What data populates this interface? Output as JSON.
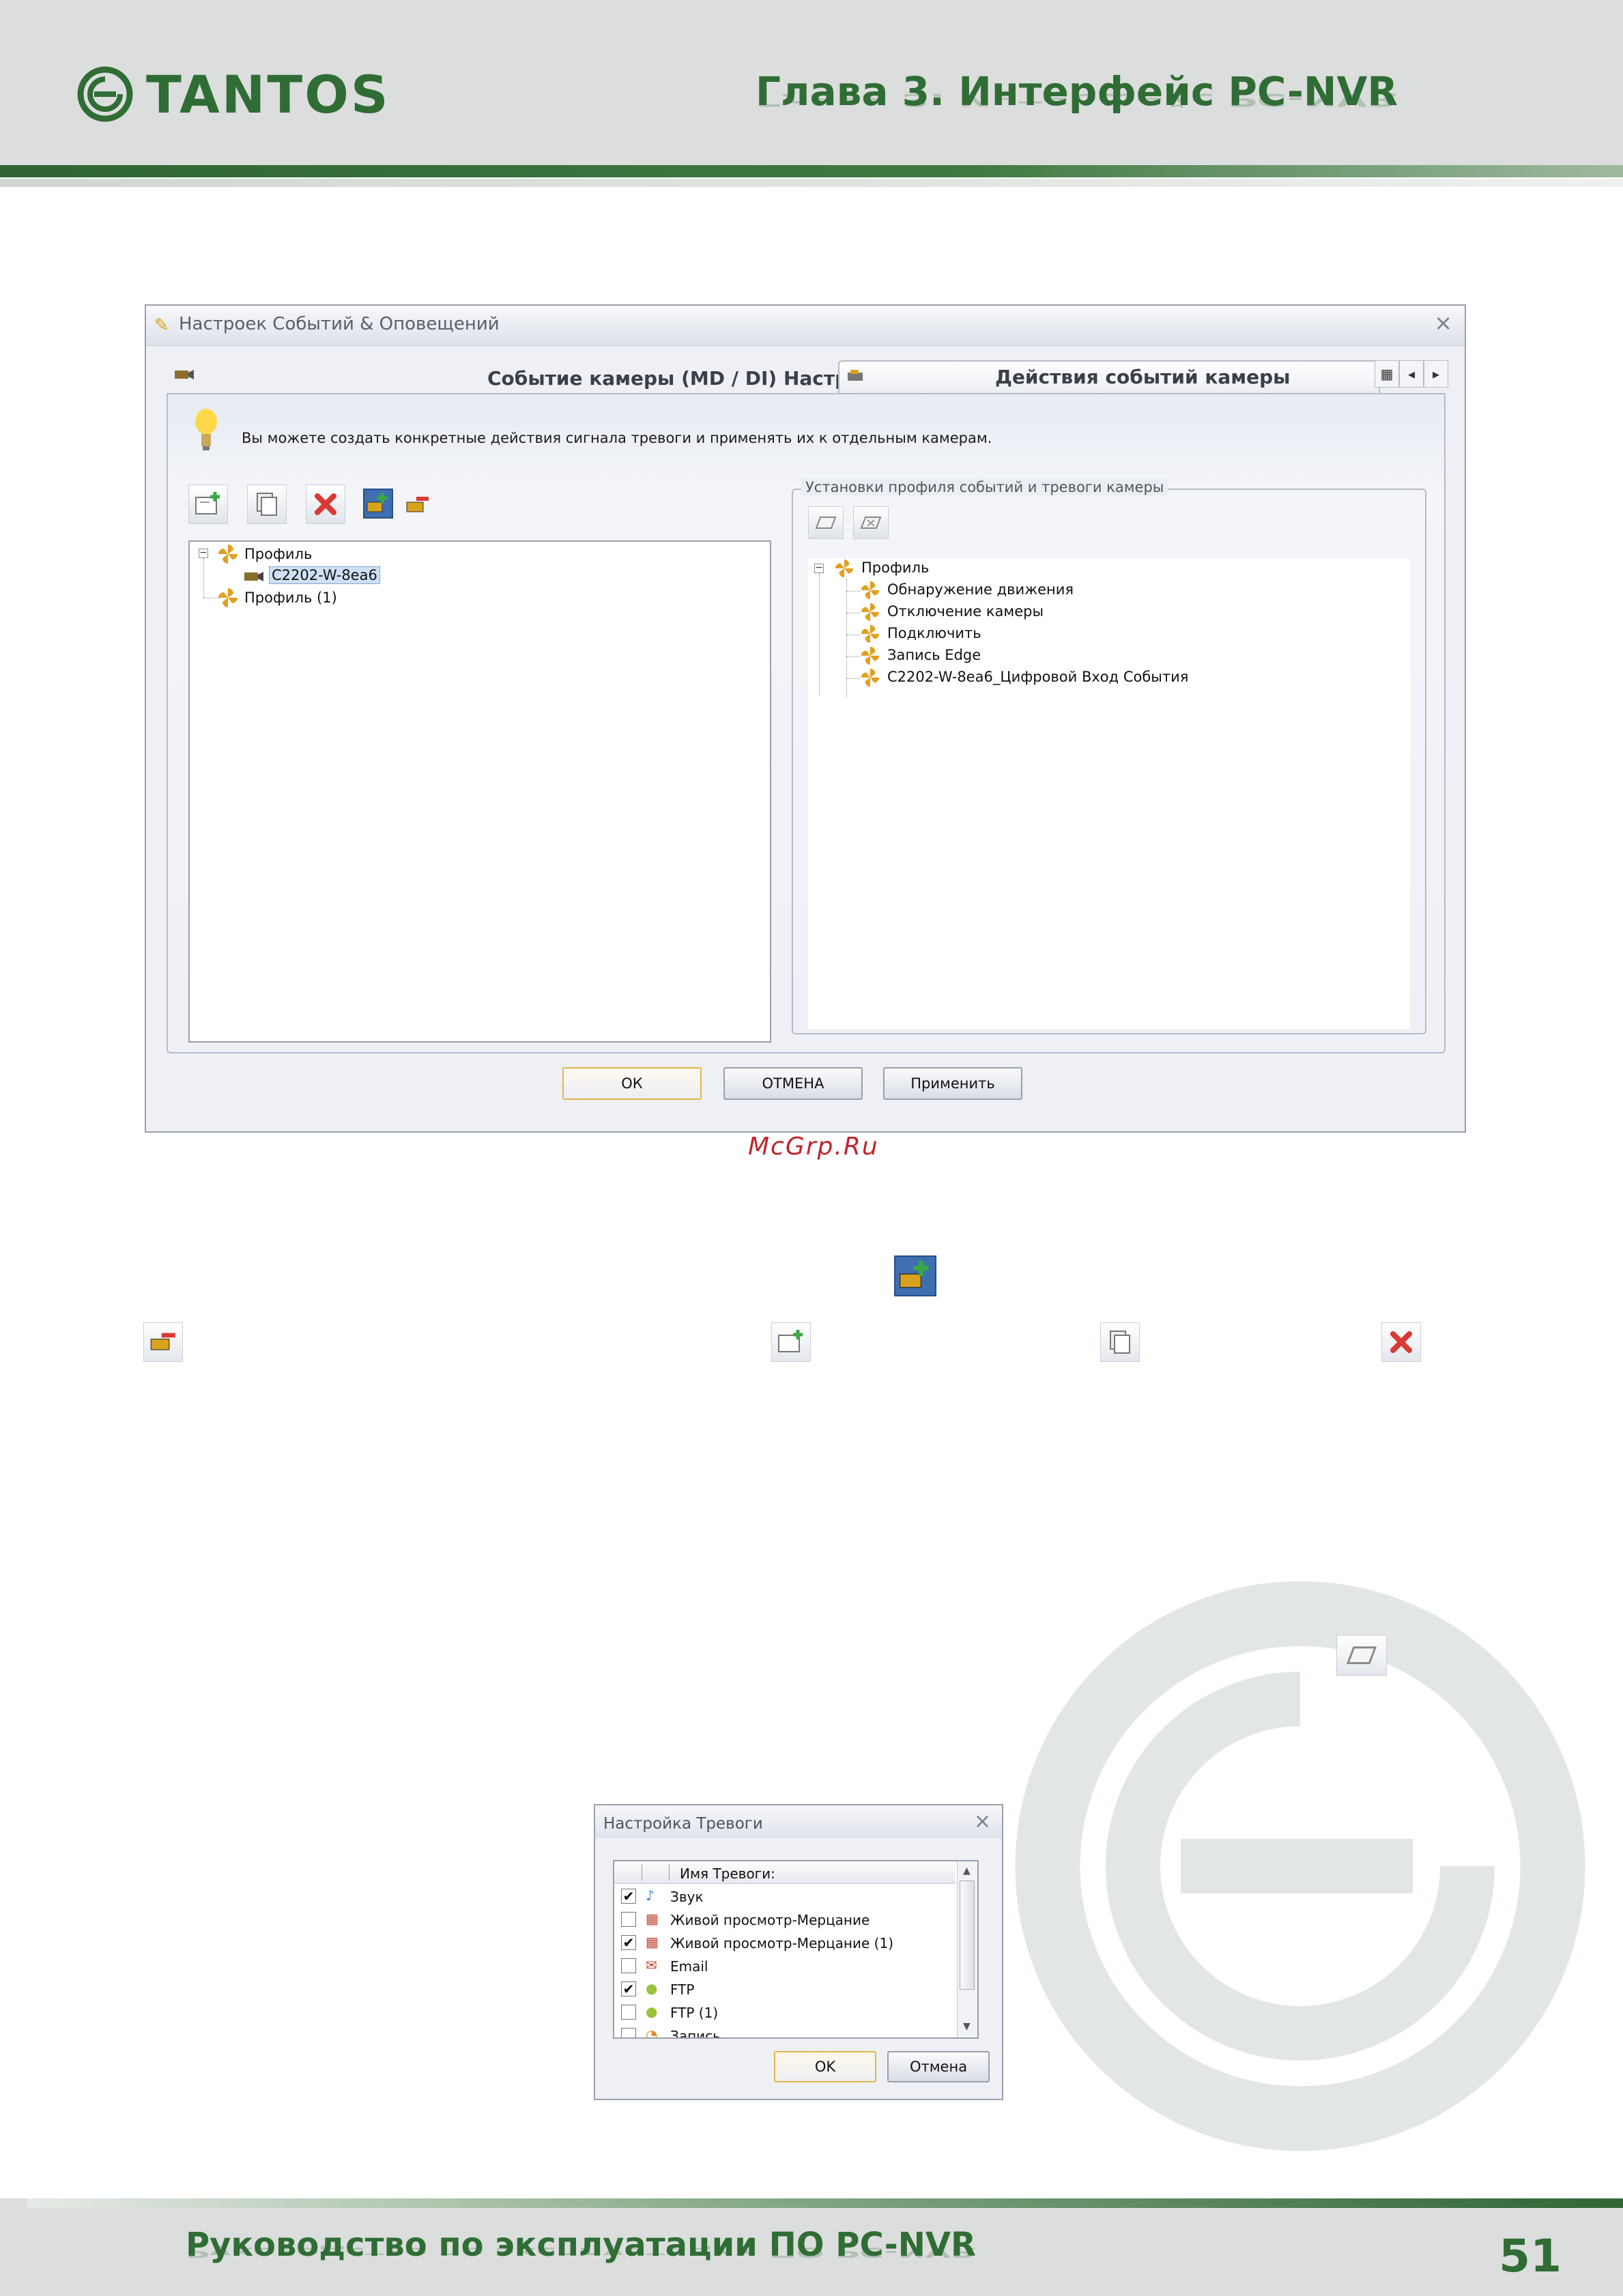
{
  "header": {
    "brand": "TANTOS",
    "chapter": "Глава 3. Интерфейс PC-NVR"
  },
  "footer": {
    "manual_title": "Руководство по эксплуатации ПО PC-NVR",
    "page_number": "51"
  },
  "watermark_text": "McGrp.Ru",
  "main_dialog": {
    "title": "Настроек Событий & Оповещений",
    "close_icon": "×",
    "tabs": [
      {
        "label": "Событие камеры (MD / DI) Настройка",
        "active": false
      },
      {
        "label": "Действия событий камеры",
        "active": true
      }
    ],
    "tab_nav": {
      "left": "◂",
      "right": "▸"
    },
    "hint": "Вы можете создать конкретные действия сигнала тревоги и применять их к отдельным камерам.",
    "left_tree": {
      "root": "Профиль",
      "child": "C2202-W-8ea6",
      "sibling": "Профиль (1)"
    },
    "group_title": "Установки профиля событий и тревоги камеры",
    "right_tree": {
      "root": "Профиль",
      "items": [
        "Обнаружение движения",
        "Отключение камеры",
        "Подключить",
        "Запись Edge",
        "C2202-W-8ea6_Цифровой Вход События"
      ]
    },
    "buttons": {
      "ok": "ОК",
      "cancel": "ОТМЕНА",
      "apply": "Применить"
    }
  },
  "alarm_dialog": {
    "title": "Настройка Тревоги",
    "close_icon": "×",
    "column_header": "Имя Тревоги:",
    "rows": [
      {
        "label": "Звук",
        "checked": true,
        "icon": "sound-icon"
      },
      {
        "label": "Живой просмотр-Мерцание",
        "checked": false,
        "icon": "live-view-icon"
      },
      {
        "label": "Живой просмотр-Мерцание (1)",
        "checked": true,
        "icon": "live-view-icon"
      },
      {
        "label": "Email",
        "checked": false,
        "icon": "email-icon"
      },
      {
        "label": "FTP",
        "checked": true,
        "icon": "ftp-icon"
      },
      {
        "label": "FTP (1)",
        "checked": false,
        "icon": "ftp-icon"
      },
      {
        "label": "Запись",
        "checked": false,
        "icon": "record-icon"
      }
    ],
    "check_mark": "✔",
    "buttons": {
      "ok": "OK",
      "cancel": "Отмена"
    }
  },
  "colors": {
    "brand_green": "#2f6d35",
    "fan_orange": "#e0a020",
    "delete_red": "#d93a35"
  }
}
